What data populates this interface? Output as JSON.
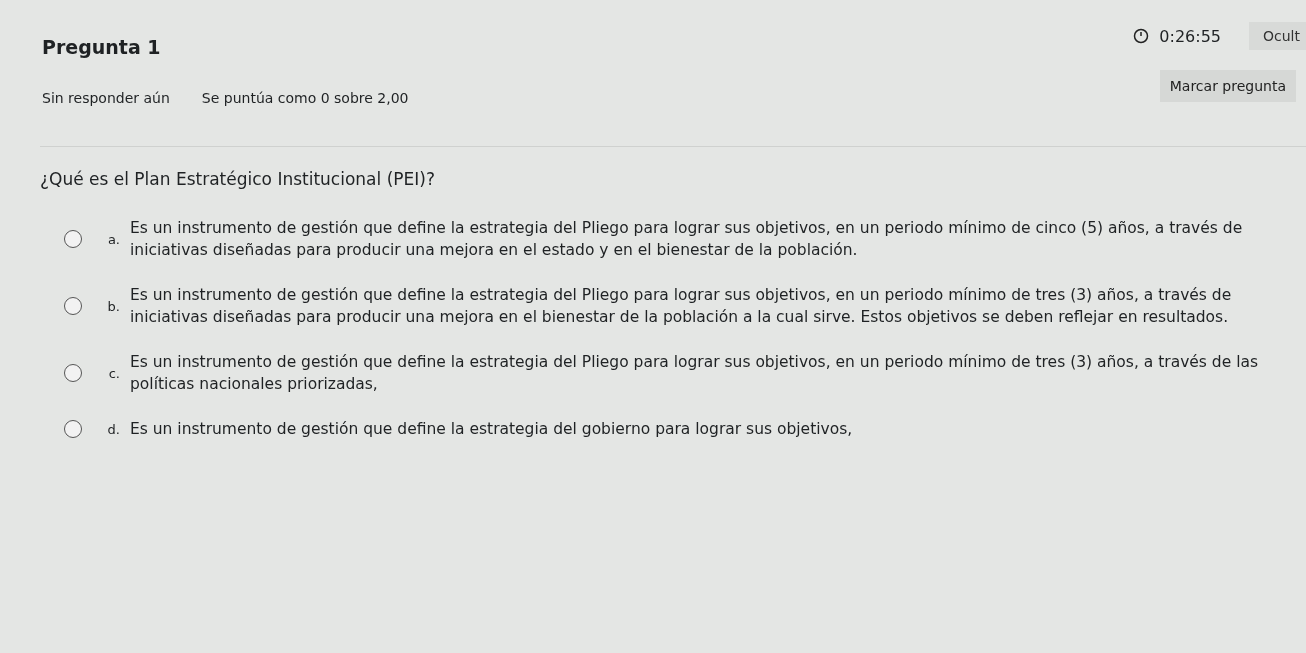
{
  "timer": {
    "time": "0:26:55",
    "hide_label": "Ocult"
  },
  "question": {
    "title": "Pregunta 1",
    "status": "Sin responder aún",
    "grade": "Se puntúa como 0 sobre 2,00",
    "flag_label": "Marcar pregunta",
    "text": "¿Qué es el Plan Estratégico Institucional (PEI)?"
  },
  "options": [
    {
      "letter": "a.",
      "text": "Es un instrumento de gestión que define la estrategia del Pliego para lograr sus objetivos, en un periodo mínimo de cinco (5) años, a través de iniciativas diseñadas para producir una mejora en el estado y en el bienestar de la población.",
      "selected": false
    },
    {
      "letter": "b.",
      "text": "Es un instrumento de gestión que define la estrategia del Pliego para lograr sus objetivos, en un periodo mínimo de tres (3) años, a través de iniciativas diseñadas para producir una mejora en el bienestar de la población a la cual sirve. Estos objetivos se deben reflejar en resultados.",
      "selected": false
    },
    {
      "letter": "c.",
      "text": "Es un instrumento de gestión que define la estrategia del Pliego para lograr sus objetivos, en un periodo mínimo de tres (3) años, a través de las políticas nacionales priorizadas,",
      "selected": false
    },
    {
      "letter": "d.",
      "text": "Es un instrumento de gestión que define la estrategia del gobierno para lograr sus objetivos,",
      "selected": false
    }
  ]
}
